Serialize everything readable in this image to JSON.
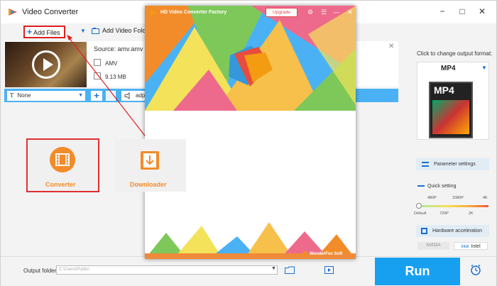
{
  "app": {
    "title": "Video Converter",
    "accent_color": "#18a0f0",
    "window_controls": {
      "minimize": "−",
      "maximize": "□",
      "close": "✕"
    }
  },
  "toolbar": {
    "add_files_label": "Add Files",
    "add_files_icon": "plus-icon",
    "dropdown_icon": "▼",
    "add_folder_label": "Add Video Folder",
    "add_folder_icon": "folder-icon"
  },
  "video_item": {
    "source_label": "Source: amv.amv",
    "format": "AMV",
    "size": "9.13 MB",
    "close_icon": "✕"
  },
  "edit_bar": {
    "subtitle_value": "None",
    "subtitle_caret": "▼",
    "add_subtitle_label": "+",
    "audio_value": "adpc"
  },
  "output_panel": {
    "click_to_change": "Click to change output format:",
    "format_name": "MP4",
    "format_caret": "▼",
    "format_badge": "MP4",
    "parameter_settings_label": "Parameter settings",
    "quick_setting_label": "Quick setting",
    "quality_ticks_top": [
      "480P",
      "1080P",
      "4K"
    ],
    "quality_ticks_bottom": [
      "Default",
      "720P",
      "2K"
    ],
    "quality_level": 0,
    "hardware_accel_label": "Hardware acceleration",
    "nvidia_label": "NVIDIA",
    "intel_label": "Intel",
    "intel_logo": "intel"
  },
  "bottom": {
    "output_folder_label": "Output folder:",
    "output_folder_value": "C:\\Users\\Public\\",
    "output_folder_caret": "▼",
    "run_label": "Run"
  },
  "launcher": {
    "title": "HD Video Converter Factory",
    "upgrade_label": "Upgrade",
    "controls": {
      "settings": "⚙",
      "menu": "☰",
      "minimize": "—",
      "close": "✕"
    },
    "converter_label": "Converter",
    "downloader_label": "Downloader",
    "brand": "WonderFox Soft",
    "brand_colors": [
      "#f28c2a",
      "#4ab2f4",
      "#f3e25a",
      "#ee6a8c",
      "#7ec85a"
    ]
  }
}
